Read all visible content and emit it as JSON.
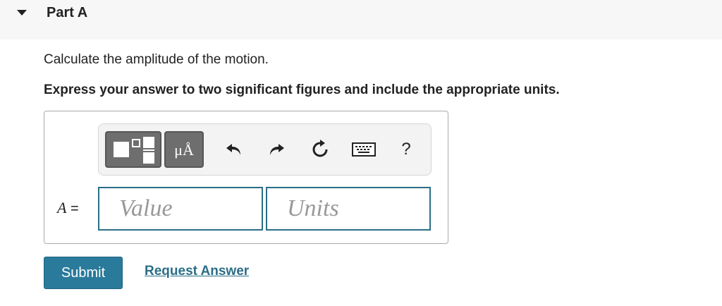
{
  "part": {
    "title": "Part A"
  },
  "question": {
    "text": "Calculate the amplitude of the motion."
  },
  "instruction": {
    "text": "Express your answer to two significant figures and include the appropriate units."
  },
  "toolbar": {
    "units_label": "μÅ",
    "help_label": "?",
    "icons": [
      "templates-icon",
      "units-icon",
      "undo-icon",
      "redo-icon",
      "reset-icon",
      "keyboard-icon",
      "help-icon"
    ]
  },
  "answer": {
    "variable": "A",
    "equals": "=",
    "value_placeholder": "Value",
    "units_placeholder": "Units"
  },
  "actions": {
    "submit_label": "Submit",
    "request_label": "Request Answer"
  },
  "colors": {
    "accent": "#2a7a9b",
    "input_border": "#2a6e86",
    "toolbar_button": "#6e6e6e"
  }
}
